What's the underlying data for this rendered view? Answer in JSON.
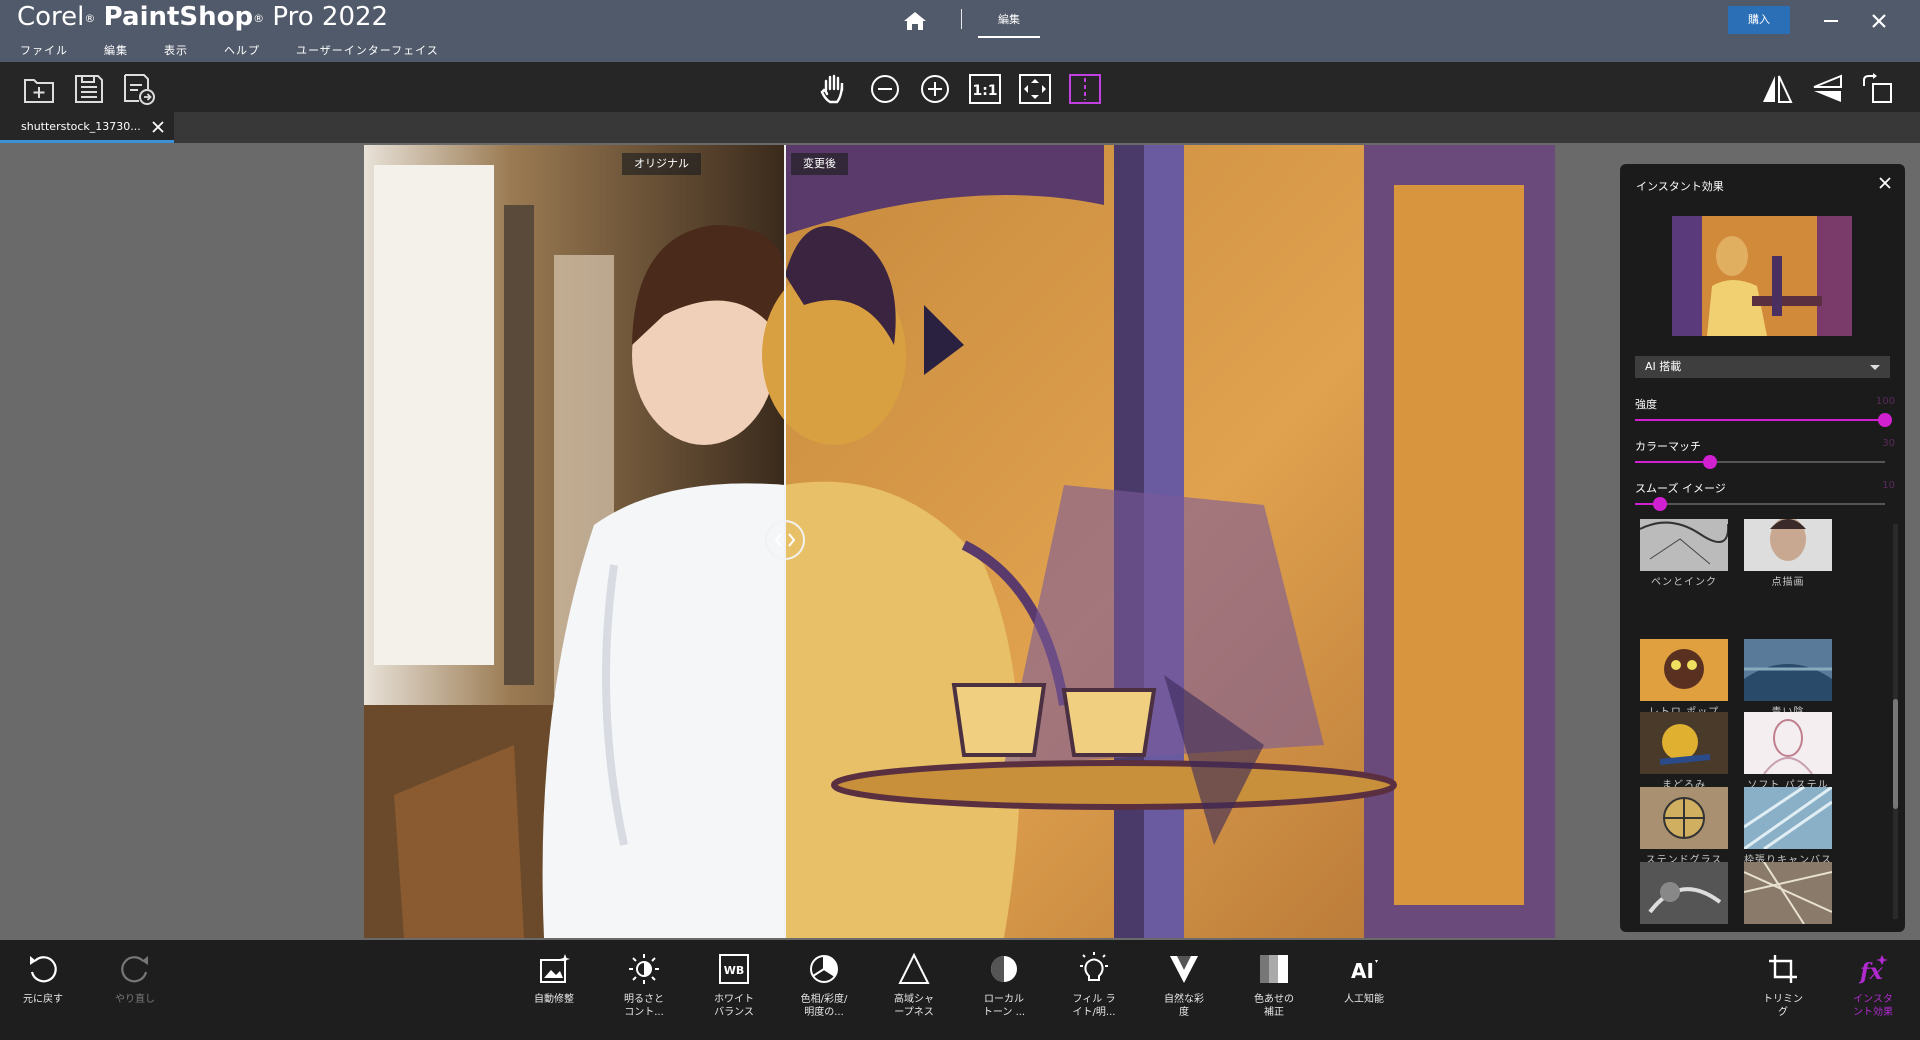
{
  "app": {
    "brand_corel": "Corel",
    "brand_reg": "®",
    "brand_product": "PaintShop",
    "brand_reg2": "®",
    "brand_version": "Pro 2022"
  },
  "menu": [
    "ファイル",
    "編集",
    "表示",
    "ヘルプ",
    "ユーザーインターフェイス"
  ],
  "header": {
    "home_icon": "home-icon",
    "tab_edit": "編集",
    "buy_label": "購入"
  },
  "toolbar": {
    "left_icons": [
      "new-file-icon",
      "save-icon",
      "save-as-icon"
    ],
    "center_icons": [
      "pan-hand-icon",
      "zoom-out-icon",
      "zoom-in-icon",
      "actual-size-icon",
      "fit-to-window-icon",
      "compare-split-icon"
    ],
    "actual_size_label": "1:1",
    "right_icons": [
      "flip-horizontal-icon",
      "flip-vertical-icon",
      "rotate-icon"
    ]
  },
  "document": {
    "tab_name": "shutterstock_13730..."
  },
  "compare": {
    "original_label": "オリジナル",
    "modified_label": "変更後",
    "split_position": 0.353
  },
  "panel": {
    "title": "インスタント効果",
    "category": "AI 搭載",
    "sliders": [
      {
        "label": "強度",
        "value": "100",
        "fraction": 1.0
      },
      {
        "label": "カラーマッチ",
        "value": "30",
        "fraction": 0.3
      },
      {
        "label": "スムーズ イメージ",
        "value": "10",
        "fraction": 0.1
      }
    ],
    "effects": [
      {
        "label": "ペンとインク",
        "style": "ink"
      },
      {
        "label": "点描画",
        "style": "pointillism"
      },
      {
        "label": "レトロ ポップ",
        "style": "retro"
      },
      {
        "label": "青い陰",
        "style": "blue"
      },
      {
        "label": "まどろみ",
        "style": "slumber"
      },
      {
        "label": "ソフト パステル",
        "style": "pastel"
      },
      {
        "label": "ステンドグラス",
        "style": "stained"
      },
      {
        "label": "枠張りキャンバス",
        "style": "canvas"
      },
      {
        "label": "",
        "style": "dark"
      },
      {
        "label": "",
        "style": "mosaic"
      }
    ]
  },
  "bottom": {
    "undo": "元に戻す",
    "redo": "やり直し",
    "tools": [
      {
        "label1": "自動修整",
        "label2": "",
        "icon": "auto-fix-icon"
      },
      {
        "label1": "明るさと",
        "label2": "コント...",
        "icon": "brightness-icon"
      },
      {
        "label1": "ホワイト",
        "label2": "バランス",
        "icon": "white-balance-icon"
      },
      {
        "label1": "色相/彩度/",
        "label2": "明度の...",
        "icon": "hue-saturation-icon"
      },
      {
        "label1": "高域シャ",
        "label2": "ープネス",
        "icon": "sharpness-icon"
      },
      {
        "label1": "ローカル",
        "label2": "トーン ...",
        "icon": "local-tone-icon"
      },
      {
        "label1": "フィル ラ",
        "label2": "イト/明...",
        "icon": "fill-light-icon"
      },
      {
        "label1": "自然な彩",
        "label2": "度",
        "icon": "vibrance-icon"
      },
      {
        "label1": "色あせの",
        "label2": "補正",
        "icon": "fade-correction-icon"
      },
      {
        "label1": "人工知能",
        "label2": "",
        "icon": "ai-icon"
      }
    ],
    "crop_label1": "トリミン",
    "crop_label2": "グ",
    "fx_label1": "インスタ",
    "fx_label2": "ント効果"
  }
}
